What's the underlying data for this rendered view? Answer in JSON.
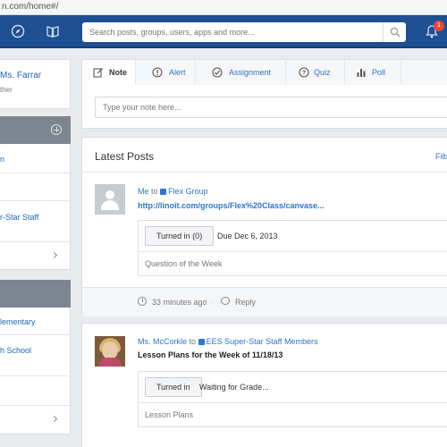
{
  "browser": {
    "url": "n.com/home#/"
  },
  "nav": {
    "search_placeholder": "Search posts, groups, users, apps and more...",
    "notification_count": "1",
    "brand_color": "#1f4f93"
  },
  "profile": {
    "name": "Ms. Farrar",
    "role": "ther"
  },
  "groups": {
    "items": [
      {
        "label": "n"
      },
      {
        "label": ""
      },
      {
        "label": "r-Star Staff"
      }
    ]
  },
  "schools": {
    "items": [
      {
        "label": "lementary"
      },
      {
        "label": "h School"
      }
    ]
  },
  "composer": {
    "tabs": [
      {
        "label": "Note",
        "icon": "note-icon"
      },
      {
        "label": "Alert",
        "icon": "alert-icon"
      },
      {
        "label": "Assignment",
        "icon": "assignment-icon"
      },
      {
        "label": "Quiz",
        "icon": "quiz-icon"
      },
      {
        "label": "Poll",
        "icon": "poll-icon"
      }
    ],
    "note_placeholder": "Type your note here..."
  },
  "feed": {
    "title": "Latest Posts",
    "filter_label": "Filte",
    "posts": [
      {
        "author": "Me",
        "to_word": "to",
        "group": "Flex Group",
        "link": "http://linoit.com/groups/Flex%20Class/canvase...",
        "button": "Turned in (0)",
        "due": "Due Dec 6, 2013",
        "caption": "Question of the Week",
        "time": "33 minutes ago",
        "reply": "Reply"
      },
      {
        "author": "Ms. McCorkle",
        "to_word": "to",
        "group": "EES Super-Star Staff Members",
        "title": "Lesson Plans for the Week of 11/18/13",
        "button": "Turned in",
        "status": "Waiting for Grade...",
        "caption": "Lesson Plans"
      }
    ]
  }
}
